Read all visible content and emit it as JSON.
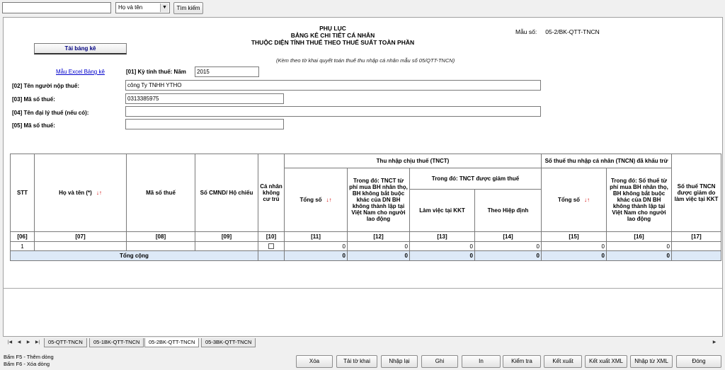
{
  "toolbar": {
    "search_value": "",
    "select_value": "Họ và tên",
    "search_button": "Tìm kiếm"
  },
  "header": {
    "title1": "PHỤ LỤC",
    "title2": "BẢNG KÊ CHI TIẾT CÁ NHÂN",
    "title3": "THUỘC DIỆN TÍNH THUẾ THEO THUẾ SUẤT TOÀN PHẦN",
    "form_label": "Mẫu số:",
    "form_code": "05-2/BK-QTT-TNCN",
    "note": "(Kèm theo tờ khai quyết toán thuế thu nhập cá nhân mẫu số 05/QTT-TNCN)",
    "download_button": "Tải bảng kê",
    "excel_link": "Mẫu Excel Bảng kê"
  },
  "form": {
    "period_label": "[01] Kỳ tính thuế: Năm",
    "period_value": "2015",
    "taxpayer_label": "[02] Tên người nộp thuế:",
    "taxpayer_value": "công Ty TNHH YTHO",
    "taxcode_label": "[03] Mã số thuế:",
    "taxcode_value": "0313385975",
    "agent_label": "[04] Tên đại lý thuế (nếu có):",
    "agent_value": "",
    "agent_taxcode_label": "[05] Mã số thuế:",
    "agent_taxcode_value": ""
  },
  "table": {
    "h_stt": "STT",
    "h_name": "Họ và tên (*)",
    "h_taxcode": "Mã số thuế",
    "h_id": "Số CMND/ Hộ chiếu",
    "h_nonresident": "Cá nhân không cư trú",
    "h_income": "Thu nhập chịu thuế (TNCT)",
    "h_income_total": "Tổng số",
    "h_income_insurance": "Trong đó: TNCT từ phí mua BH nhân thọ, BH không bắt buộc khác của DN BH không thành lập tại Việt Nam cho người lao động",
    "h_income_reduced": "Trong đó: TNCT được giảm thuế",
    "h_income_kkt": "Làm việc tại KKT",
    "h_income_treaty": "Theo Hiệp định",
    "h_tax": "Số thuế thu nhập cá nhân (TNCN) đã khấu trừ",
    "h_tax_total": "Tổng số",
    "h_tax_insurance": "Trong đó: Số thuế từ phí mua BH nhân thọ, BH không bắt buộc khác của DN BH không thành lập tại Việt Nam cho người lao động",
    "h_tax_reduced": "Số thuế TNCN được giảm do làm việc tại KKT",
    "sort_arrows": "↓↑",
    "col_numbers": [
      "[06]",
      "[07]",
      "[08]",
      "[09]",
      "[10]",
      "[11]",
      "[12]",
      "[13]",
      "[14]",
      "[15]",
      "[16]",
      "[17]"
    ],
    "row": {
      "stt": "1",
      "name": "",
      "taxcode": "",
      "id": "",
      "v11": "0",
      "v12": "0",
      "v13": "0",
      "v14": "0",
      "v15": "0",
      "v16": "0"
    },
    "total_label": "Tổng cộng",
    "totals": {
      "v11": "0",
      "v12": "0",
      "v13": "0",
      "v14": "0",
      "v15": "0",
      "v16": "0"
    }
  },
  "sheet_tabs": [
    "05-QTT-TNCN",
    "05-1BK-QTT-TNCN",
    "05-2BK-QTT-TNCN",
    "05-3BK-QTT-TNCN"
  ],
  "hints": {
    "f5": "Bấm F5 - Thêm dòng",
    "f6": "Bấm F6 - Xóa dòng"
  },
  "buttons": {
    "delete": "Xóa",
    "load": "Tải tờ khai",
    "reenter": "Nhập lại",
    "save": "Ghi",
    "print": "In",
    "check": "Kiểm tra",
    "export": "Kết xuất",
    "export_xml": "Kết xuất XML",
    "import_xml": "Nhập từ XML",
    "close": "Đóng"
  }
}
